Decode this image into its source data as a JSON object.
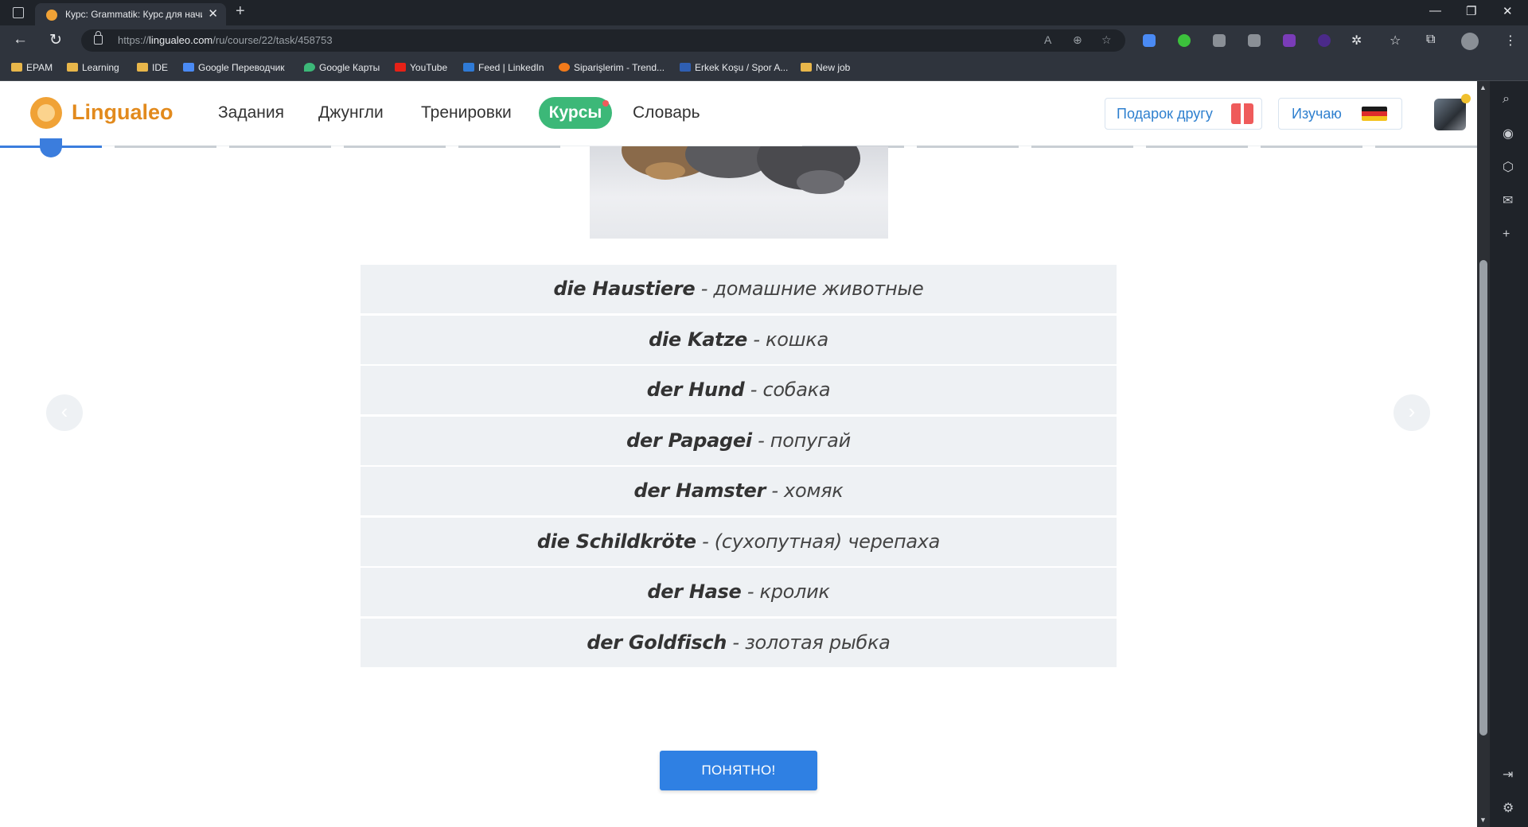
{
  "browser": {
    "tab_title": "Курс: Grammatik: Курс для начи",
    "url_prefix": "https://",
    "url_host": "lingualeo.com",
    "url_path": "/ru/course/22/task/458753",
    "bookmarks": [
      {
        "label": "EPAM",
        "icon": "folder-icon"
      },
      {
        "label": "Learning",
        "icon": "folder-icon"
      },
      {
        "label": "IDE",
        "icon": "folder-icon"
      },
      {
        "label": "Google Переводчик",
        "icon": "google-translate-icon"
      },
      {
        "label": "Google Карты",
        "icon": "google-maps-icon"
      },
      {
        "label": "YouTube",
        "icon": "youtube-icon"
      },
      {
        "label": "Feed | LinkedIn",
        "icon": "linkedin-icon"
      },
      {
        "label": "Siparişlerim - Trend...",
        "icon": "trendyol-icon"
      },
      {
        "label": "Erkek Koşu / Spor A...",
        "icon": "decathlon-icon"
      },
      {
        "label": "New job",
        "icon": "folder-icon"
      }
    ]
  },
  "site": {
    "logo": "Lingualeo",
    "nav": [
      "Задания",
      "Джунгли",
      "Тренировки",
      "Курсы",
      "Словарь"
    ],
    "gift_button": "Подарок другу",
    "learning_button": "Изучаю",
    "learning_language_flag": "germany-flag-icon"
  },
  "vocab": [
    {
      "de": "die Haustiere",
      "ru": "домашние животные"
    },
    {
      "de": "die Katze",
      "ru": "кошка"
    },
    {
      "de": "der Hund",
      "ru": "собака"
    },
    {
      "de": "der Papagei",
      "ru": "попугай"
    },
    {
      "de": "der Hamster",
      "ru": "хомяк"
    },
    {
      "de": "die Schildkröte",
      "ru": "(сухопутная) черепаха"
    },
    {
      "de": "der Hase",
      "ru": "кролик"
    },
    {
      "de": "der Goldfisch",
      "ru": "золотая рыбка"
    }
  ],
  "separator": " - ",
  "ok_button": "ПОНЯТНО!",
  "colors": {
    "accent_green": "#3cb878",
    "brand_orange": "#e28a1d",
    "primary_blue": "#2f80e3",
    "row_background": "#eef1f4"
  }
}
